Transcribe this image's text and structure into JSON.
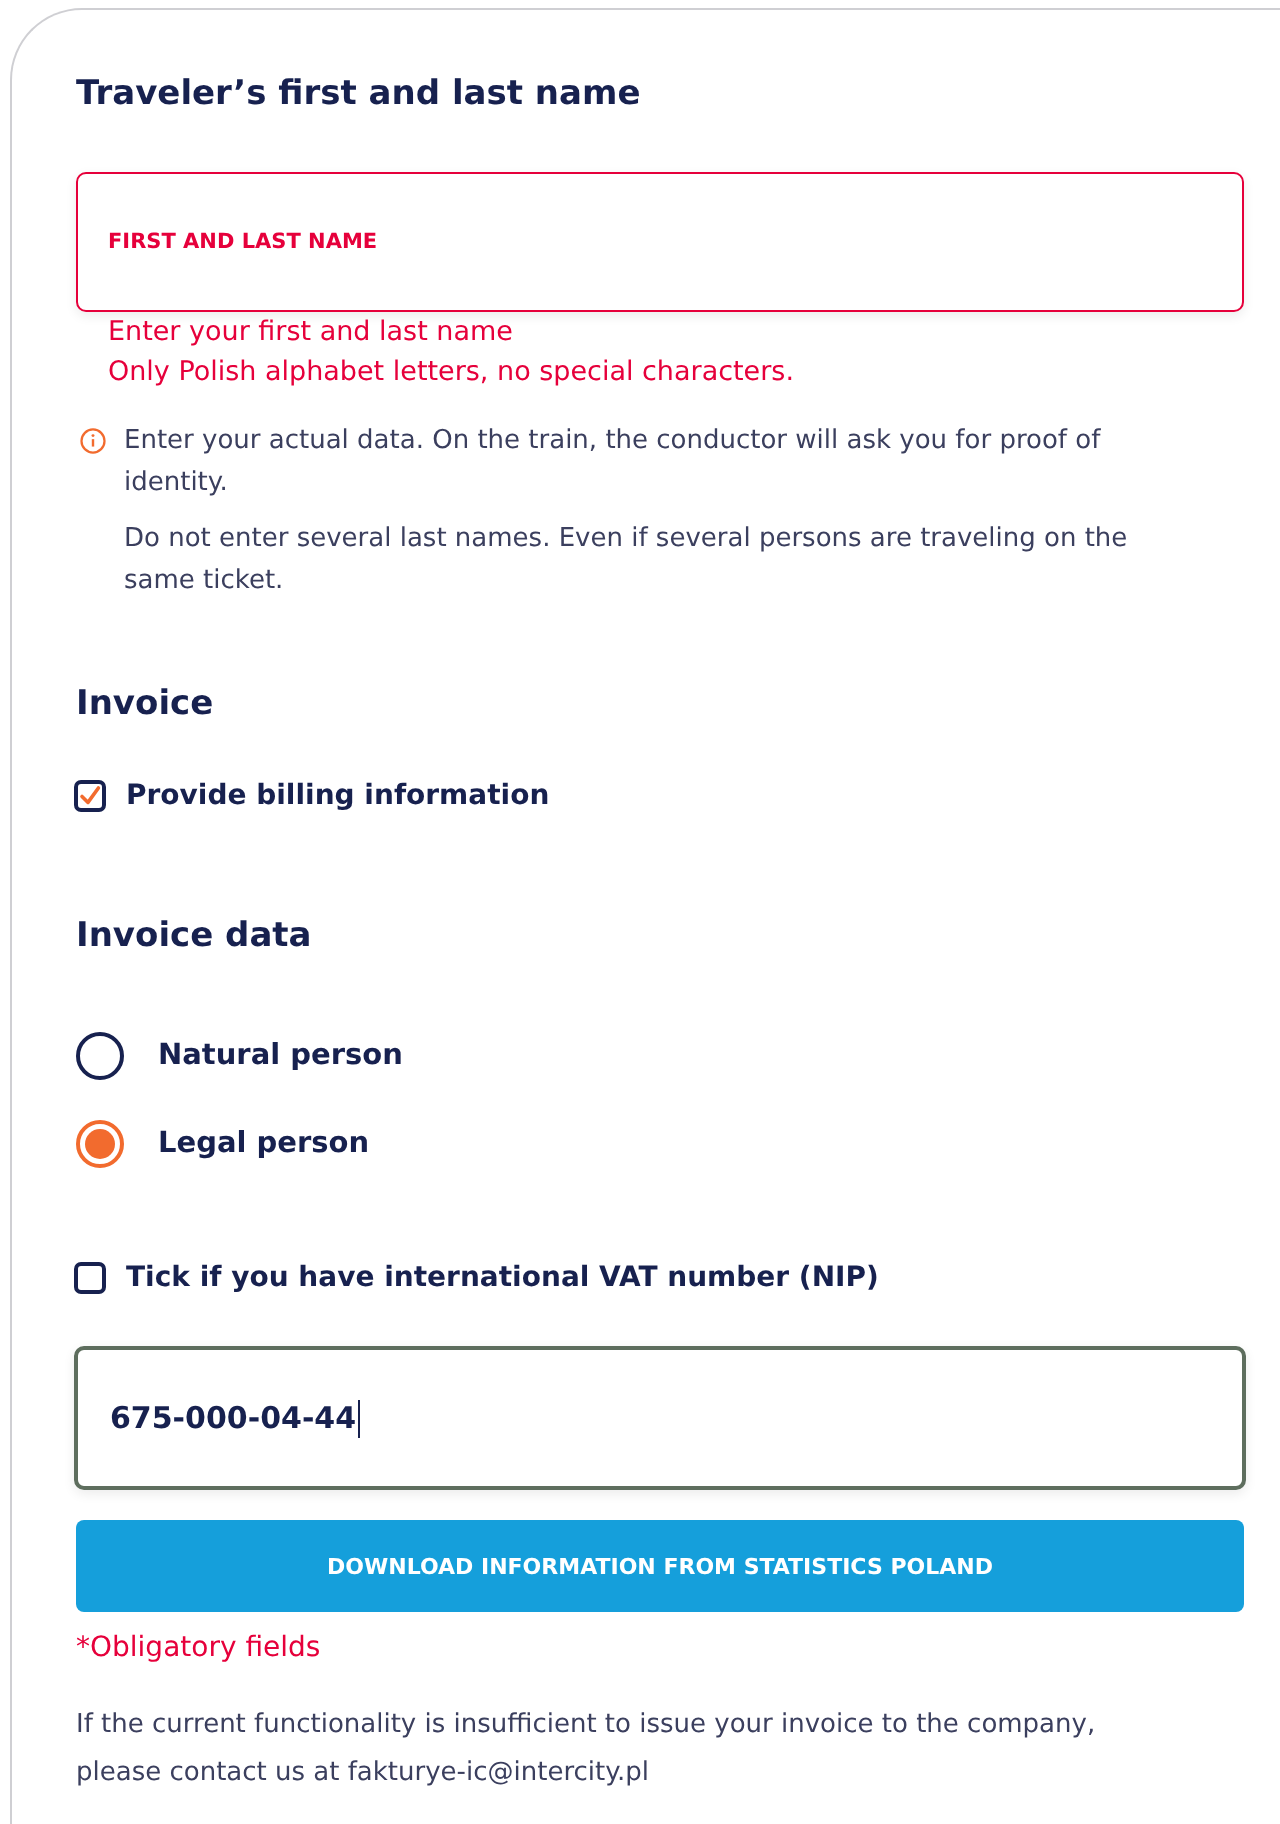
{
  "traveler": {
    "heading": "Traveler’s first and last name",
    "name_field": {
      "placeholder": "FIRST AND LAST NAME",
      "invalid": true
    },
    "errors": [
      "Enter your first and last name",
      "Only Polish alphabet letters, no special characters."
    ],
    "notes": [
      "Enter your actual data. On the train, the conductor will ask you for proof of identity.",
      "Do not enter several last names. Even if several persons are traveling on the same ticket."
    ]
  },
  "invoice": {
    "heading": "Invoice",
    "billing_checkbox": {
      "label": "Provide billing information",
      "checked": true
    }
  },
  "invoice_data": {
    "heading": "Invoice data",
    "person_types": [
      {
        "label": "Natural person",
        "selected": false
      },
      {
        "label": "Legal person",
        "selected": true
      }
    ],
    "vat_checkbox": {
      "label": "Tick if you have international VAT number (NIP)",
      "checked": false
    },
    "nip_field": {
      "value": "675-000-04-44",
      "focused": true
    },
    "download_button": "DOWNLOAD INFORMATION FROM STATISTICS POLAND",
    "required_note": "*Obligatory fields",
    "contact_note": "If the current functionality is insufficient to issue your invoice to the company, please contact us at fakturye-ic@intercity.pl"
  }
}
